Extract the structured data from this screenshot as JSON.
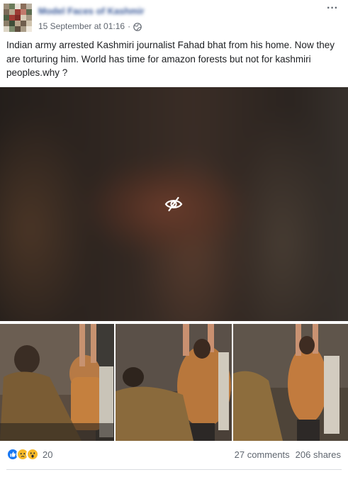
{
  "header": {
    "page_name": "Model Faces of Kashmir",
    "date": "15 September at 01:16",
    "separator": "·",
    "privacy_icon": "globe-icon",
    "more_label": "···"
  },
  "post": {
    "caption": "Indian army arrested Kashmiri journalist Fahad bhat from his home. Now they are torturing him. World has time for amazon forests but not for kashmiri peoples.why ?"
  },
  "media": {
    "main_icon": "hidden-eye-icon",
    "thumbnails": [
      "photo-thumbnail-1",
      "photo-thumbnail-2",
      "photo-thumbnail-3"
    ]
  },
  "footer": {
    "reaction_icons": [
      "like-icon",
      "sad-icon",
      "wow-icon"
    ],
    "reaction_count": "20",
    "comments": "27 comments",
    "shares": "206 shares"
  },
  "colors": {
    "link_blue": "#385898",
    "meta_gray": "#616770",
    "like_blue": "#1877f2",
    "reaction_yellow": "#f7b928"
  }
}
